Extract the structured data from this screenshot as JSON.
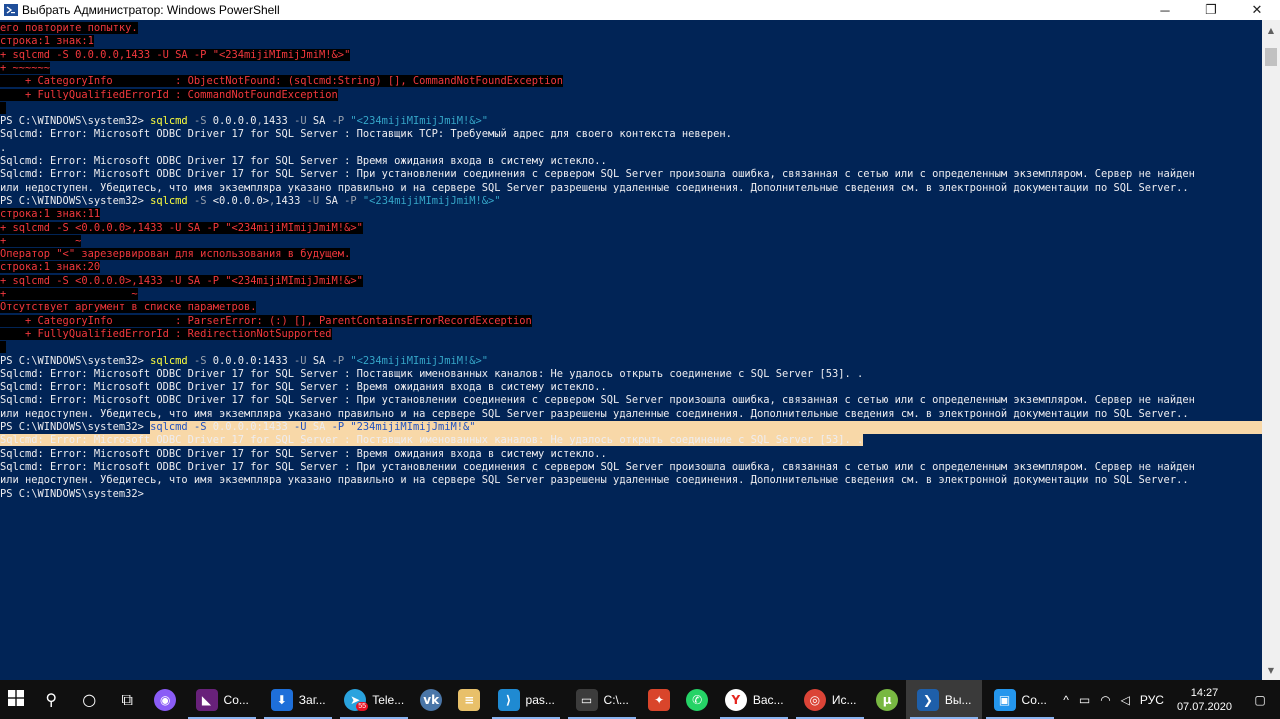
{
  "window": {
    "title": "Выбрать Администратор: Windows PowerShell",
    "minimize": "─",
    "maximize": "❐",
    "close": "✕"
  },
  "console": {
    "lines": [
      {
        "segs": [
          {
            "t": "его повторите попытку.",
            "s": "err"
          }
        ]
      },
      {
        "segs": [
          {
            "t": "строка:1 знак:1",
            "s": "err"
          }
        ]
      },
      {
        "segs": [
          {
            "t": "+ sqlcmd -S 0.0.0.0,1433 -U SA -P \"<234mijiMImijJmiM!&>\"",
            "s": "err"
          }
        ]
      },
      {
        "segs": [
          {
            "t": "+ ~~~~~~",
            "s": "err"
          }
        ]
      },
      {
        "segs": [
          {
            "t": "    + CategoryInfo          : ObjectNotFound: (sqlcmd:String) [], CommandNotFoundException",
            "s": "err"
          }
        ]
      },
      {
        "segs": [
          {
            "t": "    + FullyQualifiedErrorId : CommandNotFoundException",
            "s": "err"
          }
        ]
      },
      {
        "segs": [
          {
            "t": " ",
            "s": "err"
          }
        ]
      },
      {
        "segs": [
          {
            "t": "PS C:\\WINDOWS\\system32> ",
            "s": "w"
          },
          {
            "t": "sqlcmd",
            "s": "y"
          },
          {
            "t": " -S ",
            "s": "g"
          },
          {
            "t": "0.0.0.0",
            "s": "w"
          },
          {
            "t": ",",
            "s": "g"
          },
          {
            "t": "1433 ",
            "s": "w"
          },
          {
            "t": "-U ",
            "s": "g"
          },
          {
            "t": "SA ",
            "s": "w"
          },
          {
            "t": "-P ",
            "s": "g"
          },
          {
            "t": "\"<234mijiMImijJmiM!&>\"",
            "s": "c"
          }
        ]
      },
      {
        "segs": [
          {
            "t": "Sqlcmd: Error: Microsoft ODBC Driver 17 for SQL Server : Поставщик TCP: Требуемый адрес для своего контекста неверен.",
            "s": "w"
          }
        ]
      },
      {
        "segs": [
          {
            "t": ".",
            "s": "w"
          }
        ]
      },
      {
        "segs": [
          {
            "t": "Sqlcmd: Error: Microsoft ODBC Driver 17 for SQL Server : Время ожидания входа в систему истекло..",
            "s": "w"
          }
        ]
      },
      {
        "segs": [
          {
            "t": "Sqlcmd: Error: Microsoft ODBC Driver 17 for SQL Server : При установлении соединения с сервером SQL Server произошла ошибка, связанная с сетью или с определенным экземпляром. Сервер не найден",
            "s": "w"
          }
        ]
      },
      {
        "segs": [
          {
            "t": "или недоступен. Убедитесь, что имя экземпляра указано правильно и на сервере SQL Server разрешены удаленные соединения. Дополнительные сведения см. в электронной документации по SQL Server..",
            "s": "w"
          }
        ]
      },
      {
        "segs": [
          {
            "t": "PS C:\\WINDOWS\\system32> ",
            "s": "w"
          },
          {
            "t": "sqlcmd",
            "s": "y"
          },
          {
            "t": " -S ",
            "s": "g"
          },
          {
            "t": "<0.0.0.0>",
            "s": "w"
          },
          {
            "t": ",",
            "s": "g"
          },
          {
            "t": "1433 ",
            "s": "w"
          },
          {
            "t": "-U ",
            "s": "g"
          },
          {
            "t": "SA ",
            "s": "w"
          },
          {
            "t": "-P ",
            "s": "g"
          },
          {
            "t": "\"<234mijiMImijJmiM!&>\"",
            "s": "c"
          }
        ]
      },
      {
        "segs": [
          {
            "t": "строка:1 знак:11",
            "s": "err"
          }
        ]
      },
      {
        "segs": [
          {
            "t": "+ sqlcmd -S <0.0.0.0>,1433 -U SA -P \"<234mijiMImijJmiM!&>\"",
            "s": "err"
          }
        ]
      },
      {
        "segs": [
          {
            "t": "+           ~",
            "s": "err"
          }
        ]
      },
      {
        "segs": [
          {
            "t": "Оператор \"<\" зарезервирован для использования в будущем.",
            "s": "err"
          }
        ]
      },
      {
        "segs": [
          {
            "t": "строка:1 знак:20",
            "s": "err"
          }
        ]
      },
      {
        "segs": [
          {
            "t": "+ sqlcmd -S <0.0.0.0>,1433 -U SA -P \"<234mijiMImijJmiM!&>\"",
            "s": "err"
          }
        ]
      },
      {
        "segs": [
          {
            "t": "+                    ~",
            "s": "err"
          }
        ]
      },
      {
        "segs": [
          {
            "t": "Отсутствует аргумент в списке параметров.",
            "s": "err"
          }
        ]
      },
      {
        "segs": [
          {
            "t": "    + CategoryInfo          : ParserError: (:) [], ParentContainsErrorRecordException",
            "s": "err"
          }
        ]
      },
      {
        "segs": [
          {
            "t": "    + FullyQualifiedErrorId : RedirectionNotSupported",
            "s": "err"
          }
        ]
      },
      {
        "segs": [
          {
            "t": " ",
            "s": "err"
          }
        ]
      },
      {
        "segs": [
          {
            "t": "PS C:\\WINDOWS\\system32> ",
            "s": "w"
          },
          {
            "t": "sqlcmd",
            "s": "y"
          },
          {
            "t": " -S ",
            "s": "g"
          },
          {
            "t": "0.0.0.0:1433 ",
            "s": "w"
          },
          {
            "t": "-U ",
            "s": "g"
          },
          {
            "t": "SA ",
            "s": "w"
          },
          {
            "t": "-P ",
            "s": "g"
          },
          {
            "t": "\"<234mijiMImijJmiM!&>\"",
            "s": "c"
          }
        ]
      },
      {
        "segs": [
          {
            "t": "Sqlcmd: Error: Microsoft ODBC Driver 17 for SQL Server : Поставщик именованных каналов: Не удалось открыть соединение с SQL Server [53]. .",
            "s": "w"
          }
        ]
      },
      {
        "segs": [
          {
            "t": "Sqlcmd: Error: Microsoft ODBC Driver 17 for SQL Server : Время ожидания входа в систему истекло..",
            "s": "w"
          }
        ]
      },
      {
        "segs": [
          {
            "t": "Sqlcmd: Error: Microsoft ODBC Driver 17 for SQL Server : При установлении соединения с сервером SQL Server произошла ошибка, связанная с сетью или с определенным экземпляром. Сервер не найден",
            "s": "w"
          }
        ]
      },
      {
        "segs": [
          {
            "t": "или недоступен. Убедитесь, что имя экземпляра указано правильно и на сервере SQL Server разрешены удаленные соединения. Дополнительные сведения см. в электронной документации по SQL Server..",
            "s": "w"
          }
        ]
      },
      {
        "segs": [
          {
            "t": "PS C:\\WINDOWS\\system32> ",
            "s": "w"
          },
          {
            "t": "sqlcmd",
            "s": "y"
          },
          {
            "t": " -S ",
            "s": "g"
          },
          {
            "t": "0.0.0.0:1433 ",
            "s": "w"
          },
          {
            "t": "-U ",
            "s": "g"
          },
          {
            "t": "SA ",
            "s": "w"
          },
          {
            "t": "-P ",
            "s": "g"
          },
          {
            "t": "\"234mijiMImijJmiM!&\"",
            "s": "c"
          }
        ],
        "hl": "partial"
      },
      {
        "segs": [
          {
            "t": "Sqlcmd: Error: Microsoft ODBC Driver 17 for SQL Server : Поставщик именованных каналов: Не удалось открыть соединение с SQL Server [53]. .",
            "s": "w"
          }
        ],
        "hl": "full"
      },
      {
        "segs": [
          {
            "t": "Sqlcmd: Error: Microsoft ODBC Driver 17 for SQL Server : Время ожидания входа в систему истекло..",
            "s": "w"
          }
        ]
      },
      {
        "segs": [
          {
            "t": "Sqlcmd: Error: Microsoft ODBC Driver 17 for SQL Server : При установлении соединения с сервером SQL Server произошла ошибка, связанная с сетью или с определенным экземпляром. Сервер не найден",
            "s": "w"
          }
        ]
      },
      {
        "segs": [
          {
            "t": "или недоступен. Убедитесь, что имя экземпляра указано правильно и на сервере SQL Server разрешены удаленные соединения. Дополнительные сведения см. в электронной документации по SQL Server..",
            "s": "w"
          }
        ]
      },
      {
        "segs": [
          {
            "t": "PS C:\\WINDOWS\\system32>",
            "s": "w"
          }
        ]
      }
    ]
  },
  "taskbar": {
    "start_icon": "windows-logo-icon",
    "apps": [
      {
        "name": "search",
        "icon": "search-icon",
        "glyph": "⚲",
        "color": "#101010",
        "label": ""
      },
      {
        "name": "task-view",
        "icon": "cortana-ring-icon",
        "glyph": "○",
        "color": "#101010",
        "label": ""
      },
      {
        "name": "timeline",
        "icon": "task-view-icon",
        "glyph": "⧉",
        "color": "#101010",
        "label": ""
      },
      {
        "name": "alice",
        "icon": "yandex-alice-icon",
        "glyph": "◉",
        "color": "#8a5cf6",
        "label": ""
      },
      {
        "name": "visual-studio",
        "icon": "visual-studio-icon",
        "glyph": "◣",
        "color": "#68217a",
        "label": "Co..."
      },
      {
        "name": "downloads",
        "icon": "download-arrow-icon",
        "glyph": "⬇",
        "color": "#1e6fd9",
        "label": "Заг..."
      },
      {
        "name": "telegram",
        "icon": "telegram-icon",
        "glyph": "➤",
        "color": "#2aa3de",
        "label": "Tele...",
        "badge": "55"
      },
      {
        "name": "vk",
        "icon": "vk-icon",
        "glyph": "vk",
        "color": "#4a76a8",
        "label": ""
      },
      {
        "name": "notepad",
        "icon": "notepad-icon",
        "glyph": "≡",
        "color": "#e8c06a",
        "label": ""
      },
      {
        "name": "vscode",
        "icon": "vscode-icon",
        "glyph": "⟩",
        "color": "#1f8ad2",
        "label": "pas..."
      },
      {
        "name": "cmd",
        "icon": "terminal-icon",
        "glyph": "▭",
        "color": "#3c3c3c",
        "label": "C:\\..."
      },
      {
        "name": "git-kraken",
        "icon": "app-swirl-icon",
        "glyph": "✦",
        "color": "#d9452b",
        "label": ""
      },
      {
        "name": "whatsapp",
        "icon": "whatsapp-icon",
        "glyph": "✆",
        "color": "#25d366",
        "label": ""
      },
      {
        "name": "yandex-browser",
        "icon": "yandex-browser-icon",
        "glyph": "Y",
        "color": "#ffffff",
        "label": "Вас..."
      },
      {
        "name": "chrome",
        "icon": "chrome-icon",
        "glyph": "◎",
        "color": "#db4437",
        "label": "Ис..."
      },
      {
        "name": "utorrent",
        "icon": "utorrent-icon",
        "glyph": "μ",
        "color": "#78b842",
        "label": ""
      },
      {
        "name": "powershell",
        "icon": "powershell-icon",
        "glyph": "❯",
        "color": "#1e5faa",
        "label": "Вы..."
      },
      {
        "name": "docker",
        "icon": "docker-icon",
        "glyph": "▣",
        "color": "#2496ed",
        "label": "Co..."
      }
    ],
    "tray": {
      "chevron": "^",
      "battery": "▭",
      "network": "◠",
      "volume": "◁",
      "language": "РУС",
      "time": "14:27",
      "date": "07.07.2020",
      "notifications": "▢"
    }
  }
}
